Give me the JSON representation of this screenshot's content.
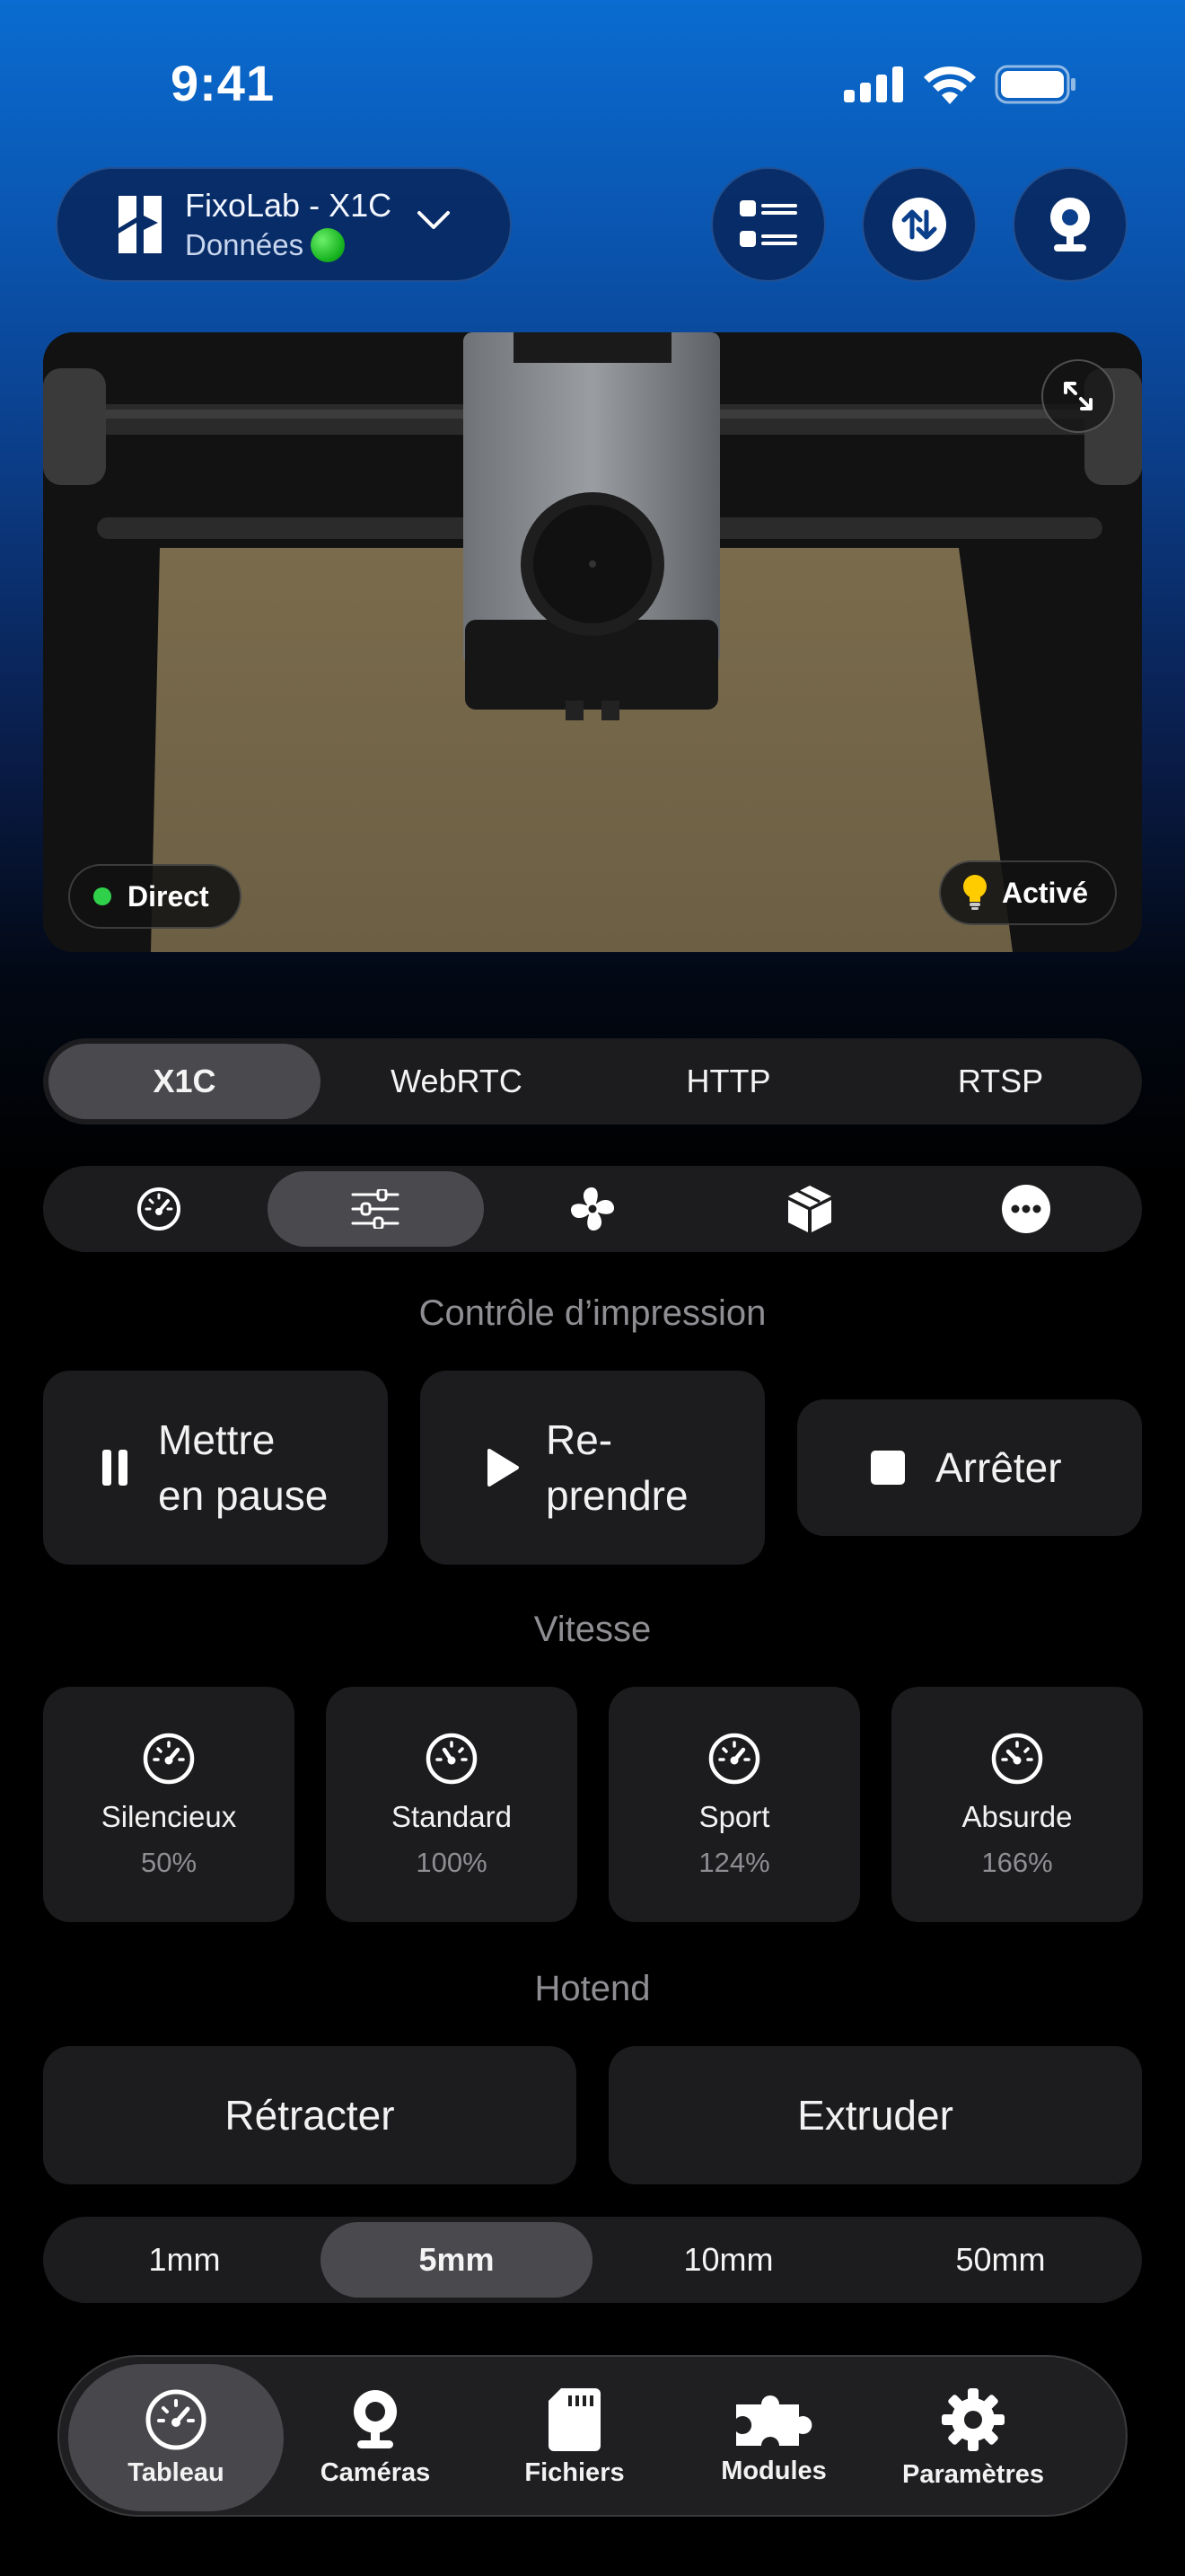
{
  "status_bar": {
    "time": "9:41"
  },
  "printer": {
    "name": "FixoLab - X1C",
    "status": "Données"
  },
  "camera": {
    "live_label": "Direct",
    "light_label": "Activé"
  },
  "stream_tabs": [
    {
      "label": "X1C",
      "active": true
    },
    {
      "label": "WebRTC",
      "active": false
    },
    {
      "label": "HTTP",
      "active": false
    },
    {
      "label": "RTSP",
      "active": false
    }
  ],
  "panel_tabs": [
    {
      "icon": "gauge-icon",
      "active": false
    },
    {
      "icon": "sliders-icon",
      "active": true
    },
    {
      "icon": "fan-icon",
      "active": false
    },
    {
      "icon": "box-icon",
      "active": false
    },
    {
      "icon": "more-icon",
      "active": false
    }
  ],
  "print_control": {
    "title": "Contrôle d’impression",
    "pause": {
      "line1": "Mettre",
      "line2": "en pause"
    },
    "resume": {
      "line1": "Re-",
      "line2": "prendre"
    },
    "stop": "Arrêter"
  },
  "speed": {
    "title": "Vitesse",
    "modes": [
      {
        "name": "Silencieux",
        "percent": "50%"
      },
      {
        "name": "Standard",
        "percent": "100%"
      },
      {
        "name": "Sport",
        "percent": "124%"
      },
      {
        "name": "Absurde",
        "percent": "166%"
      }
    ]
  },
  "hotend": {
    "title": "Hotend",
    "retract": "Rétracter",
    "extrude": "Extruder",
    "distances": [
      {
        "label": "1mm",
        "active": false
      },
      {
        "label": "5mm",
        "active": true
      },
      {
        "label": "10mm",
        "active": false
      },
      {
        "label": "50mm",
        "active": false
      }
    ]
  },
  "tab_bar": [
    {
      "label": "Tableau",
      "icon": "dashboard-icon",
      "active": true
    },
    {
      "label": "Caméras",
      "icon": "webcam-icon",
      "active": false
    },
    {
      "label": "Fichiers",
      "icon": "sd-card-icon",
      "active": false
    },
    {
      "label": "Modules",
      "icon": "puzzle-icon",
      "active": false
    },
    {
      "label": "Paramètres",
      "icon": "gear-icon",
      "active": false
    }
  ],
  "colors": {
    "accent_blue": "#0a6cd0",
    "live_green": "#2fd14a",
    "card_bg": "#1c1c1e",
    "active_seg": "#4a4a4e"
  }
}
